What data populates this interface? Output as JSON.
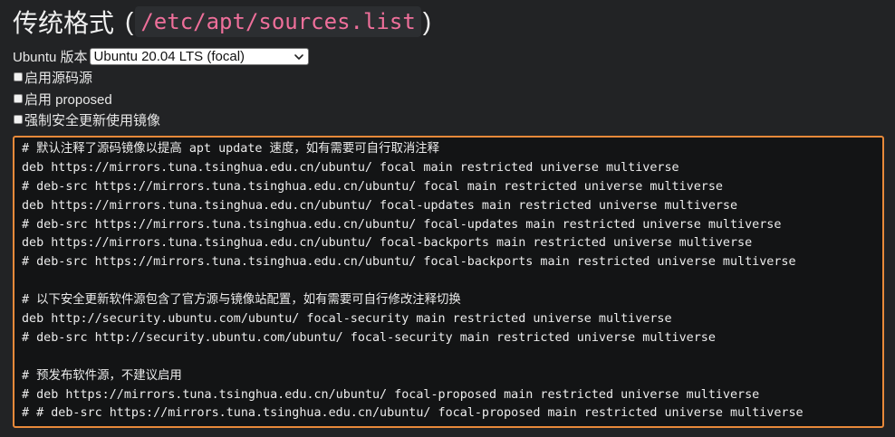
{
  "heading": {
    "title": "传统格式",
    "paren_open": "(",
    "path": "/etc/apt/sources.list",
    "paren_close": ")"
  },
  "version": {
    "label": "Ubuntu 版本",
    "selected": "Ubuntu 20.04 LTS (focal)"
  },
  "options": [
    {
      "label": "启用源码源",
      "checked": false
    },
    {
      "label": "启用 proposed",
      "checked": false
    },
    {
      "label": "强制安全更新使用镜像",
      "checked": false
    }
  ],
  "code_lines": [
    "# 默认注释了源码镜像以提高 apt update 速度，如有需要可自行取消注释",
    "deb https://mirrors.tuna.tsinghua.edu.cn/ubuntu/ focal main restricted universe multiverse",
    "# deb-src https://mirrors.tuna.tsinghua.edu.cn/ubuntu/ focal main restricted universe multiverse",
    "deb https://mirrors.tuna.tsinghua.edu.cn/ubuntu/ focal-updates main restricted universe multiverse",
    "# deb-src https://mirrors.tuna.tsinghua.edu.cn/ubuntu/ focal-updates main restricted universe multiverse",
    "deb https://mirrors.tuna.tsinghua.edu.cn/ubuntu/ focal-backports main restricted universe multiverse",
    "# deb-src https://mirrors.tuna.tsinghua.edu.cn/ubuntu/ focal-backports main restricted universe multiverse",
    "",
    "# 以下安全更新软件源包含了官方源与镜像站配置，如有需要可自行修改注释切换",
    "deb http://security.ubuntu.com/ubuntu/ focal-security main restricted universe multiverse",
    "# deb-src http://security.ubuntu.com/ubuntu/ focal-security main restricted universe multiverse",
    "",
    "# 预发布软件源，不建议启用",
    "# deb https://mirrors.tuna.tsinghua.edu.cn/ubuntu/ focal-proposed main restricted universe multiverse",
    "# # deb-src https://mirrors.tuna.tsinghua.edu.cn/ubuntu/ focal-proposed main restricted universe multiverse"
  ],
  "colors": {
    "background": "#222325",
    "code_background": "#131415",
    "focus_border": "#e8893a",
    "path_text": "#ee6f9a"
  },
  "icons": {
    "select_arrow": "chevron-down-icon"
  }
}
